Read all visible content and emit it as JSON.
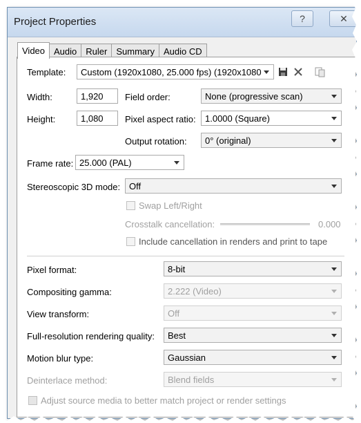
{
  "window": {
    "title": "Project Properties",
    "help_glyph": "?",
    "close_glyph": "✕"
  },
  "tabs": [
    {
      "label": "Video",
      "active": true
    },
    {
      "label": "Audio"
    },
    {
      "label": "Ruler"
    },
    {
      "label": "Summary"
    },
    {
      "label": "Audio CD"
    }
  ],
  "video": {
    "template_label": "Template:",
    "template_value": "Custom (1920x1080, 25.000 fps) (1920x1080",
    "width_label": "Width:",
    "width_value": "1,920",
    "height_label": "Height:",
    "height_value": "1,080",
    "field_order_label": "Field order:",
    "field_order_value": "None (progressive scan)",
    "pixel_aspect_label": "Pixel aspect ratio:",
    "pixel_aspect_value": "1.0000 (Square)",
    "output_rotation_label": "Output rotation:",
    "output_rotation_value": "0° (original)",
    "frame_rate_label": "Frame rate:",
    "frame_rate_value": "25.000 (PAL)",
    "stereo_label": "Stereoscopic 3D mode:",
    "stereo_value": "Off",
    "swap_label": "Swap Left/Right",
    "crosstalk_label": "Crosstalk cancellation:",
    "crosstalk_value": "0.000",
    "include_cancel_label": "Include cancellation in renders and print to tape",
    "pixel_format_label": "Pixel format:",
    "pixel_format_value": "8-bit",
    "compositing_gamma_label": "Compositing gamma:",
    "compositing_gamma_value": "2.222 (Video)",
    "view_transform_label": "View transform:",
    "view_transform_value": "Off",
    "full_res_label": "Full-resolution rendering quality:",
    "full_res_value": "Best",
    "motion_blur_label": "Motion blur type:",
    "motion_blur_value": "Gaussian",
    "deinterlace_label": "Deinterlace method:",
    "deinterlace_value": "Blend fields",
    "adjust_source_label": "Adjust source media to better match project or render settings"
  }
}
